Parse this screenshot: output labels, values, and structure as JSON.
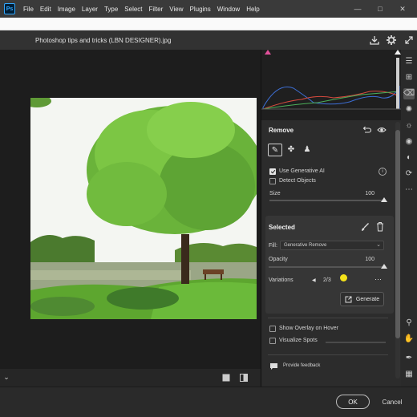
{
  "app": {
    "logo": "Ps",
    "menu": [
      "File",
      "Edit",
      "Image",
      "Layer",
      "Type",
      "Select",
      "Filter",
      "View",
      "Plugins",
      "Window",
      "Help"
    ]
  },
  "dialog": {
    "filename": "Photoshop tips and tricks (LBN DESIGNER).jpg"
  },
  "remove_panel": {
    "title": "Remove",
    "use_generative_ai": {
      "label": "Use Generative AI",
      "checked": true
    },
    "detect_objects": {
      "label": "Detect Objects",
      "checked": false
    },
    "size": {
      "label": "Size",
      "value": "100"
    }
  },
  "selected_panel": {
    "title": "Selected",
    "fill_label": "Fill:",
    "fill_value": "Generative Remove",
    "opacity": {
      "label": "Opacity",
      "value": "100"
    },
    "variations": {
      "label": "Variations",
      "value": "2/3"
    },
    "generate_label": "Generate"
  },
  "options": {
    "show_overlay": {
      "label": "Show Overlay on Hover",
      "checked": false
    },
    "visualize_spots": {
      "label": "Visualize Spots",
      "checked": false
    }
  },
  "feedback_label": "Provide feedback",
  "footer": {
    "ok_label": "OK",
    "cancel_label": "Cancel"
  },
  "colors": {
    "accent": "#31a8ff",
    "cursor": "#f4e21a"
  }
}
